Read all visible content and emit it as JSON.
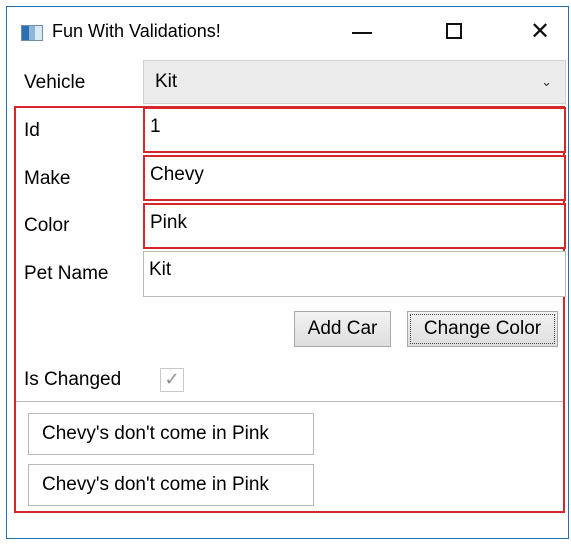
{
  "window": {
    "title": "Fun With Validations!",
    "icon": "app-window-icon",
    "controls": {
      "minimize_icon": "minimize-icon",
      "maximize_icon": "maximize-icon",
      "close_icon": "close-icon"
    }
  },
  "form": {
    "vehicle": {
      "label": "Vehicle",
      "selected": "Kit",
      "icon": "chevron-down-icon"
    },
    "fields": {
      "id": {
        "label": "Id",
        "value": "1"
      },
      "make": {
        "label": "Make",
        "value": "Chevy"
      },
      "color": {
        "label": "Color",
        "value": "Pink"
      },
      "pet_name": {
        "label": "Pet Name",
        "value": "Kit"
      }
    },
    "buttons": {
      "add_car": "Add Car",
      "change_color": "Change Color"
    },
    "is_changed": {
      "label": "Is Changed",
      "checked": true,
      "icon": "checkmark-icon"
    }
  },
  "validation": {
    "messages": [
      "Chevy's don't come in Pink",
      "Chevy's don't come in Pink"
    ],
    "error_color": "#d7262b"
  },
  "colors": {
    "window_border": "#1f6fb8",
    "combo_background": "#ebebeb",
    "button_border": "#a8a8a8"
  }
}
